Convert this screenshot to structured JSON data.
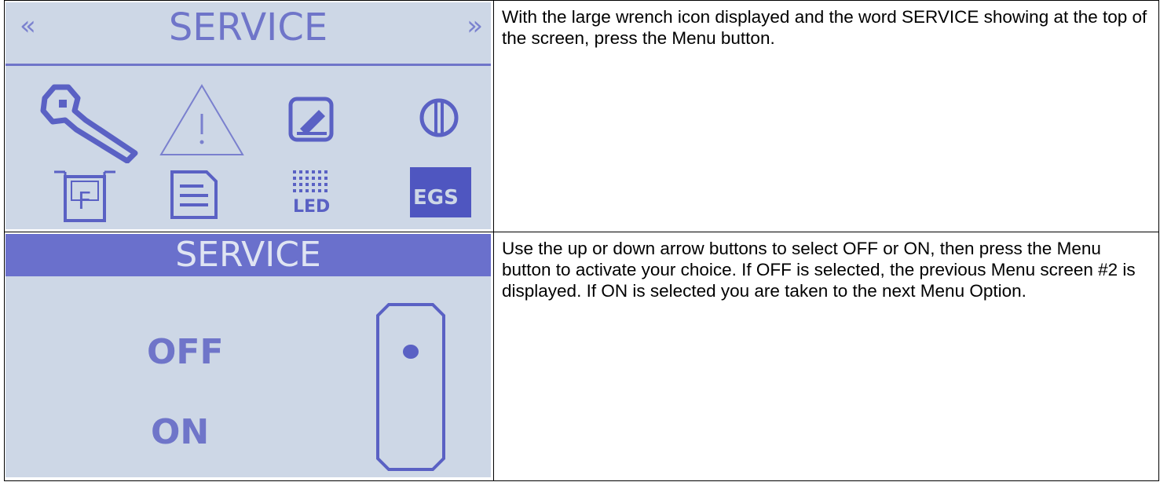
{
  "rows": [
    {
      "screen": {
        "title": "SERVICE",
        "nav_left": "«",
        "nav_right": "»",
        "icons": [
          "wrench-icon",
          "warning-triangle-icon",
          "edit-icon",
          "contrast-icon",
          "fuel-icon",
          "document-icon",
          "led-icon",
          "egs-icon"
        ],
        "led_label": "LED",
        "egs_label": "EGS",
        "fuel_label": "F"
      },
      "text": "With the large wrench icon displayed and the word SERVICE showing at the top of the screen, press the Menu button."
    },
    {
      "screen": {
        "title": "SERVICE",
        "options": [
          "OFF",
          "ON"
        ],
        "selected": "OFF"
      },
      "text": "Use the up or down arrow buttons to select OFF or ON, then press the Menu button to activate your choice. If OFF is selected, the previous Menu screen #2 is displayed. If ON is selected you are taken to the next Menu Option."
    }
  ],
  "colors": {
    "lcd_background": "#cdd7e6",
    "lcd_foreground": "#6f75c9",
    "header_bar": "#6a70cc"
  }
}
